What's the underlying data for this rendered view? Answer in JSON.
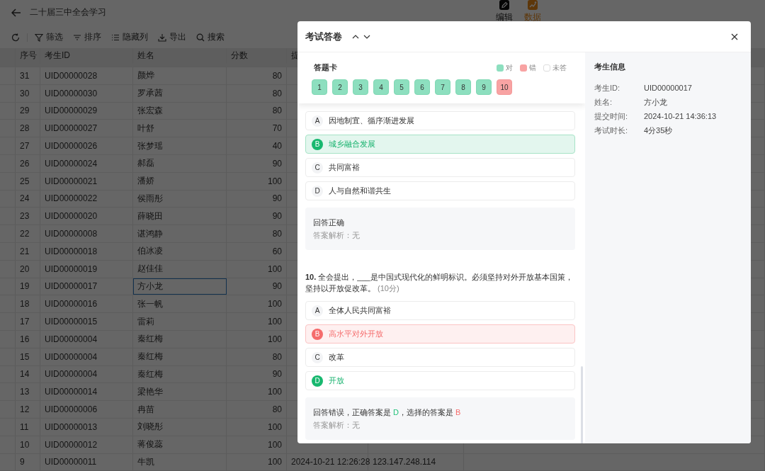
{
  "topbar": {
    "title": "二十届三中全会学习",
    "tabs": [
      {
        "label": "编辑",
        "selected": false
      },
      {
        "label": "数据",
        "selected": true
      }
    ]
  },
  "toolbar": [
    {
      "label": "筛选"
    },
    {
      "label": "排序"
    },
    {
      "label": "隐藏列"
    },
    {
      "label": "导出"
    },
    {
      "label": "搜索"
    }
  ],
  "table": {
    "columns": [
      "序号",
      "考生ID",
      "姓名",
      "分数",
      "提"
    ],
    "rows": [
      {
        "no": "31",
        "id": "UID00000028",
        "name": "颜烨",
        "score": "80",
        "selected": false
      },
      {
        "no": "30",
        "id": "UID00000030",
        "name": "罗承茜",
        "score": "80",
        "selected": false
      },
      {
        "no": "29",
        "id": "UID00000029",
        "name": "张宏森",
        "score": "80",
        "selected": false
      },
      {
        "no": "28",
        "id": "UID00000027",
        "name": "叶舒",
        "score": "70",
        "selected": false
      },
      {
        "no": "27",
        "id": "UID00000026",
        "name": "张梦瑶",
        "score": "40",
        "selected": false
      },
      {
        "no": "26",
        "id": "UID00000024",
        "name": "郝磊",
        "score": "90",
        "selected": false
      },
      {
        "no": "25",
        "id": "UID00000021",
        "name": "潘娇",
        "score": "100",
        "selected": false
      },
      {
        "no": "24",
        "id": "UID00000022",
        "name": "侯雨彤",
        "score": "90",
        "selected": false
      },
      {
        "no": "23",
        "id": "UID00000020",
        "name": "薛晓田",
        "score": "90",
        "selected": false
      },
      {
        "no": "22",
        "id": "UID00000008",
        "name": "谌鸿静",
        "score": "80",
        "selected": false
      },
      {
        "no": "21",
        "id": "UID00000018",
        "name": "伯冰凌",
        "score": "60",
        "selected": false
      },
      {
        "no": "20",
        "id": "UID00000019",
        "name": "赵佳佳",
        "score": "100",
        "selected": false
      },
      {
        "no": "19",
        "id": "UID00000017",
        "name": "方小龙",
        "score": "90",
        "selected": true
      },
      {
        "no": "18",
        "id": "UID00000016",
        "name": "张一帆",
        "score": "100",
        "selected": false
      },
      {
        "no": "17",
        "id": "UID00000015",
        "name": "雷莉",
        "score": "100",
        "selected": false
      },
      {
        "no": "16",
        "id": "UID00000004",
        "name": "秦红梅",
        "score": "100",
        "selected": false
      },
      {
        "no": "15",
        "id": "UID00000004",
        "name": "秦红梅",
        "score": "80",
        "selected": false
      },
      {
        "no": "14",
        "id": "UID00000004",
        "name": "秦红梅",
        "score": "90",
        "selected": false
      },
      {
        "no": "13",
        "id": "UID00000014",
        "name": "梁艳华",
        "score": "100",
        "selected": false
      },
      {
        "no": "12",
        "id": "UID00000006",
        "name": "冉苗",
        "score": "80",
        "selected": false
      },
      {
        "no": "11",
        "id": "UID00000013",
        "name": "刘晓彤",
        "score": "100",
        "selected": false
      },
      {
        "no": "10",
        "id": "UID00000012",
        "name": "蒋俊蕊",
        "score": "100",
        "selected": false
      },
      {
        "no": "9",
        "id": "UID00000011",
        "name": "牛凯",
        "score": "100",
        "selected": false,
        "column_5": "2024-10-21 12:26:28",
        "column_6": "123.147.248.114"
      }
    ]
  },
  "modal": {
    "title": "考试答卷",
    "answer_card": {
      "title": "答题卡",
      "legend": [
        {
          "label": "对",
          "kind": "correct"
        },
        {
          "label": "错",
          "kind": "wrong"
        },
        {
          "label": "未答",
          "kind": "unanswered"
        }
      ],
      "items": [
        {
          "label": "1",
          "correct": true
        },
        {
          "label": "2",
          "correct": true
        },
        {
          "label": "3",
          "correct": true
        },
        {
          "label": "4",
          "correct": true
        },
        {
          "label": "5",
          "correct": true
        },
        {
          "label": "6",
          "correct": true
        },
        {
          "label": "7",
          "correct": true
        },
        {
          "label": "8",
          "correct": true
        },
        {
          "label": "9",
          "correct": true
        },
        {
          "label": "10",
          "correct": false
        }
      ]
    },
    "questions": [
      {
        "options": [
          {
            "letter": "A",
            "text": "因地制宜、循序渐进发展",
            "selected": false,
            "correct": false
          },
          {
            "letter": "B",
            "text": "城乡融合发展",
            "selected": true,
            "correct": true
          },
          {
            "letter": "C",
            "text": "共同富裕",
            "selected": false,
            "correct": false
          },
          {
            "letter": "D",
            "text": "人与自然和谐共生",
            "selected": false,
            "correct": false
          }
        ],
        "result": [
          {
            "text": "回答正确",
            "kind": "plain"
          }
        ],
        "analysis": "答案解析：无"
      },
      {
        "stem": "**10.** 全会提出，___是中国式现代化的鲜明标识。必须坚持对外开放基本国策，坚持以开放促改革。",
        "points": "(10分)",
        "options": [
          {
            "letter": "A",
            "text": "全体人民共同富裕",
            "selected": false,
            "correct": false
          },
          {
            "letter": "B",
            "text": "高水平对外开放",
            "selected": true,
            "correct": false
          },
          {
            "letter": "C",
            "text": "改革",
            "selected": false,
            "correct": false
          },
          {
            "letter": "D",
            "text": "开放",
            "selected": false,
            "correct": true
          }
        ],
        "result": [
          {
            "text": "回答错误，正确答案是 ",
            "kind": "plain"
          },
          {
            "text": "D",
            "kind": "correct"
          },
          {
            "text": "，选择的答案是 ",
            "kind": "plain"
          },
          {
            "text": "B",
            "kind": "wrong"
          }
        ],
        "analysis": "答案解析：无"
      }
    ],
    "info": {
      "title": "考生信息",
      "fields": [
        {
          "label": "考生ID:",
          "value": "UID00000017"
        },
        {
          "label": "姓名:",
          "value": "方小龙"
        },
        {
          "label": "提交时间:",
          "value": "2024-10-21 14:36:13"
        },
        {
          "label": "考试时长:",
          "value": "4分35秒"
        }
      ]
    }
  }
}
